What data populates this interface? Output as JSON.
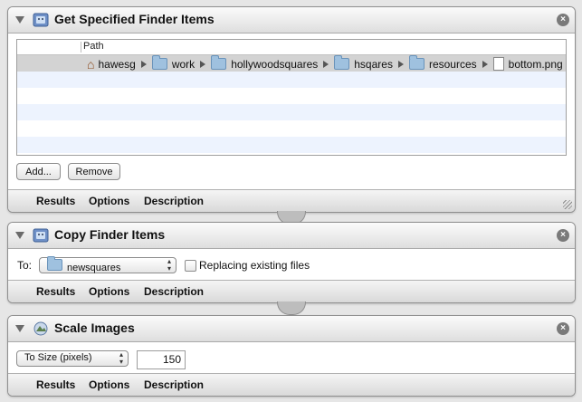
{
  "actions": [
    {
      "title": "Get Specified Finder Items",
      "table": {
        "column": "Path",
        "path": [
          {
            "icon": "home-icon",
            "label": "hawesg"
          },
          {
            "icon": "folder-icon",
            "label": "work"
          },
          {
            "icon": "folder-icon",
            "label": "hollywoodsquares"
          },
          {
            "icon": "folder-icon",
            "label": "hsqares"
          },
          {
            "icon": "folder-icon",
            "label": "resources"
          },
          {
            "icon": "file-icon",
            "label": "bottom.png"
          }
        ]
      },
      "buttons": {
        "add": "Add...",
        "remove": "Remove"
      },
      "footer": {
        "results": "Results",
        "options": "Options",
        "description": "Description"
      }
    },
    {
      "title": "Copy Finder Items",
      "to_label": "To:",
      "to_value": "newsquares",
      "checkbox_label": "Replacing existing files",
      "checkbox_checked": false,
      "footer": {
        "results": "Results",
        "options": "Options",
        "description": "Description"
      }
    },
    {
      "title": "Scale Images",
      "mode_value": "To Size (pixels)",
      "size_value": "150",
      "footer": {
        "results": "Results",
        "options": "Options",
        "description": "Description"
      }
    }
  ]
}
